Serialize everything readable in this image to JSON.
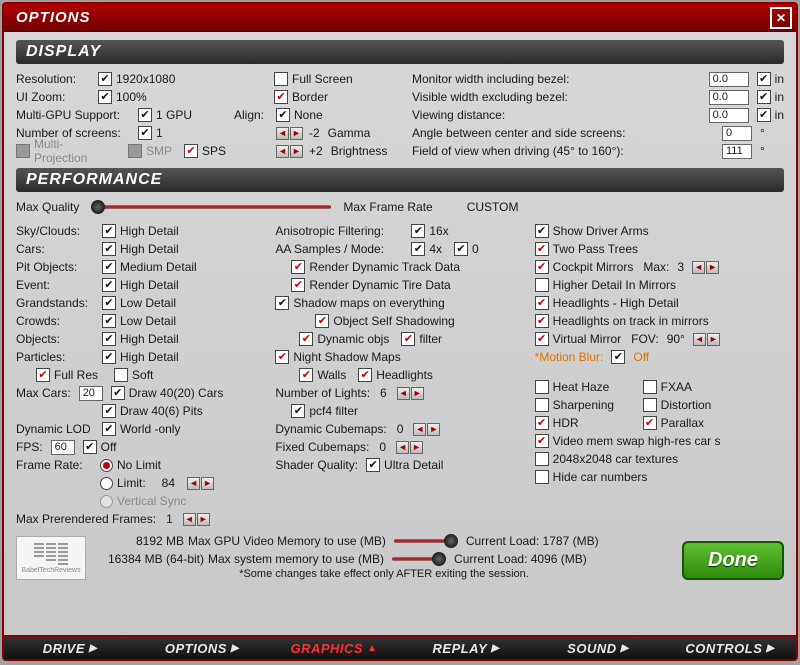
{
  "window": {
    "title": "OPTIONS"
  },
  "display": {
    "header": "DISPLAY",
    "resolution_lbl": "Resolution:",
    "resolution_val": "1920x1080",
    "uizoom_lbl": "UI Zoom:",
    "uizoom_val": "100%",
    "multigpu_lbl": "Multi-GPU Support:",
    "multigpu_val": "1 GPU",
    "numscreens_lbl": "Number of screens:",
    "numscreens_val": "1",
    "multiproj": "Multi-Projection",
    "smp": "SMP",
    "sps": "SPS",
    "fullscreen": "Full Screen",
    "border": "Border",
    "align_lbl": "Align:",
    "align_val": "None",
    "gamma_lbl": "Gamma",
    "gamma_val": "-2",
    "brightness_lbl": "Brightness",
    "brightness_val": "+2",
    "mon_bezel_lbl": "Monitor width including bezel:",
    "mon_bezel_val": "0.0",
    "unit_in": "in",
    "vis_bezel_lbl": "Visible width excluding bezel:",
    "vis_bezel_val": "0.0",
    "viewdist_lbl": "Viewing distance:",
    "viewdist_val": "0.0",
    "angle_lbl": "Angle between center and side screens:",
    "angle_val": "0",
    "deg": "°",
    "fov_lbl": "Field of view when driving (45° to 160°):",
    "fov_val": "111"
  },
  "perf": {
    "header": "PERFORMANCE",
    "maxq": "Max Quality",
    "maxfr": "Max Frame Rate",
    "custom": "CUSTOM",
    "sky_lbl": "Sky/Clouds:",
    "sky_val": "High Detail",
    "cars_lbl": "Cars:",
    "cars_val": "High Detail",
    "pit_lbl": "Pit Objects:",
    "pit_val": "Medium Detail",
    "event_lbl": "Event:",
    "event_val": "High Detail",
    "grand_lbl": "Grandstands:",
    "grand_val": "Low Detail",
    "crowds_lbl": "Crowds:",
    "crowds_val": "Low Detail",
    "objects_lbl": "Objects:",
    "objects_val": "High Detail",
    "particles_lbl": "Particles:",
    "particles_val": "High Detail",
    "fullres": "Full Res",
    "soft": "Soft",
    "maxcars_lbl": "Max Cars:",
    "maxcars_val": "20",
    "draw4020": "Draw 40(20) Cars",
    "draw406": "Draw 40(6) Pits",
    "dlod_lbl": "Dynamic LOD",
    "dlod_val": "World -only",
    "fps_lbl": "FPS:",
    "fps_val": "60",
    "fps_off": "Off",
    "framerate_lbl": "Frame Rate:",
    "nolimit": "No Limit",
    "limit": "Limit:",
    "limit_val": "84",
    "vsync": "Vertical Sync",
    "prerender_lbl": "Max Prerendered Frames:",
    "prerender_val": "1",
    "aniso_lbl": "Anisotropic Filtering:",
    "aniso_val": "16x",
    "aa_lbl": "AA Samples / Mode:",
    "aa_samples": "4x",
    "aa_mode": "0",
    "rdtd": "Render Dynamic Track Data",
    "rdtire": "Render Dynamic Tire Data",
    "shadowmaps": "Shadow maps on everything",
    "oss": "Object Self Shadowing",
    "dynobj": "Dynamic objs",
    "filter": "filter",
    "nsm": "Night Shadow Maps",
    "walls": "Walls",
    "headlights": "Headlights",
    "numlights_lbl": "Number of Lights:",
    "numlights_val": "6",
    "pcf4": "pcf4 filter",
    "dcube_lbl": "Dynamic Cubemaps:",
    "dcube_val": "0",
    "fcube_lbl": "Fixed Cubemaps:",
    "fcube_val": "0",
    "shaderq_lbl": "Shader Quality:",
    "shaderq_val": "Ultra Detail",
    "driverarms": "Show Driver Arms",
    "twopass": "Two Pass Trees",
    "cockpit": "Cockpit Mirrors",
    "cockpit_max": "Max:",
    "cockpit_val": "3",
    "higherdetail": "Higher Detail In Mirrors",
    "hlhd": "Headlights - High Detail",
    "hltrack": "Headlights on track in mirrors",
    "vmirror": "Virtual Mirror",
    "vmirror_fov": "FOV:",
    "vmirror_val": "90°",
    "motionblur_lbl": "*Motion Blur:",
    "motionblur_val": "Off",
    "heathaze": "Heat Haze",
    "fxaa": "FXAA",
    "sharpening": "Sharpening",
    "distortion": "Distortion",
    "hdr": "HDR",
    "parallax": "Parallax",
    "vmem": "Video mem swap high-res car s",
    "tex2048": "2048x2048 car textures",
    "hidecar": "Hide car numbers",
    "gpumem_val": "8192 MB",
    "gpumem_lbl": "Max GPU Video Memory to use (MB)",
    "gpuload": "Current Load: 1787 (MB)",
    "sysmem_val": "16384 MB (64-bit)",
    "sysmem_lbl": "Max system memory to use (MB)",
    "sysload": "Current Load: 4096 (MB)",
    "note": "*Some changes take effect only AFTER exiting the session."
  },
  "done": "Done",
  "tabs": {
    "drive": "DRIVE",
    "options": "OPTIONS",
    "graphics": "GRAPHICS",
    "replay": "REPLAY",
    "sound": "SOUND",
    "controls": "CONTROLS"
  },
  "logo_text": "BabelTechReviews"
}
